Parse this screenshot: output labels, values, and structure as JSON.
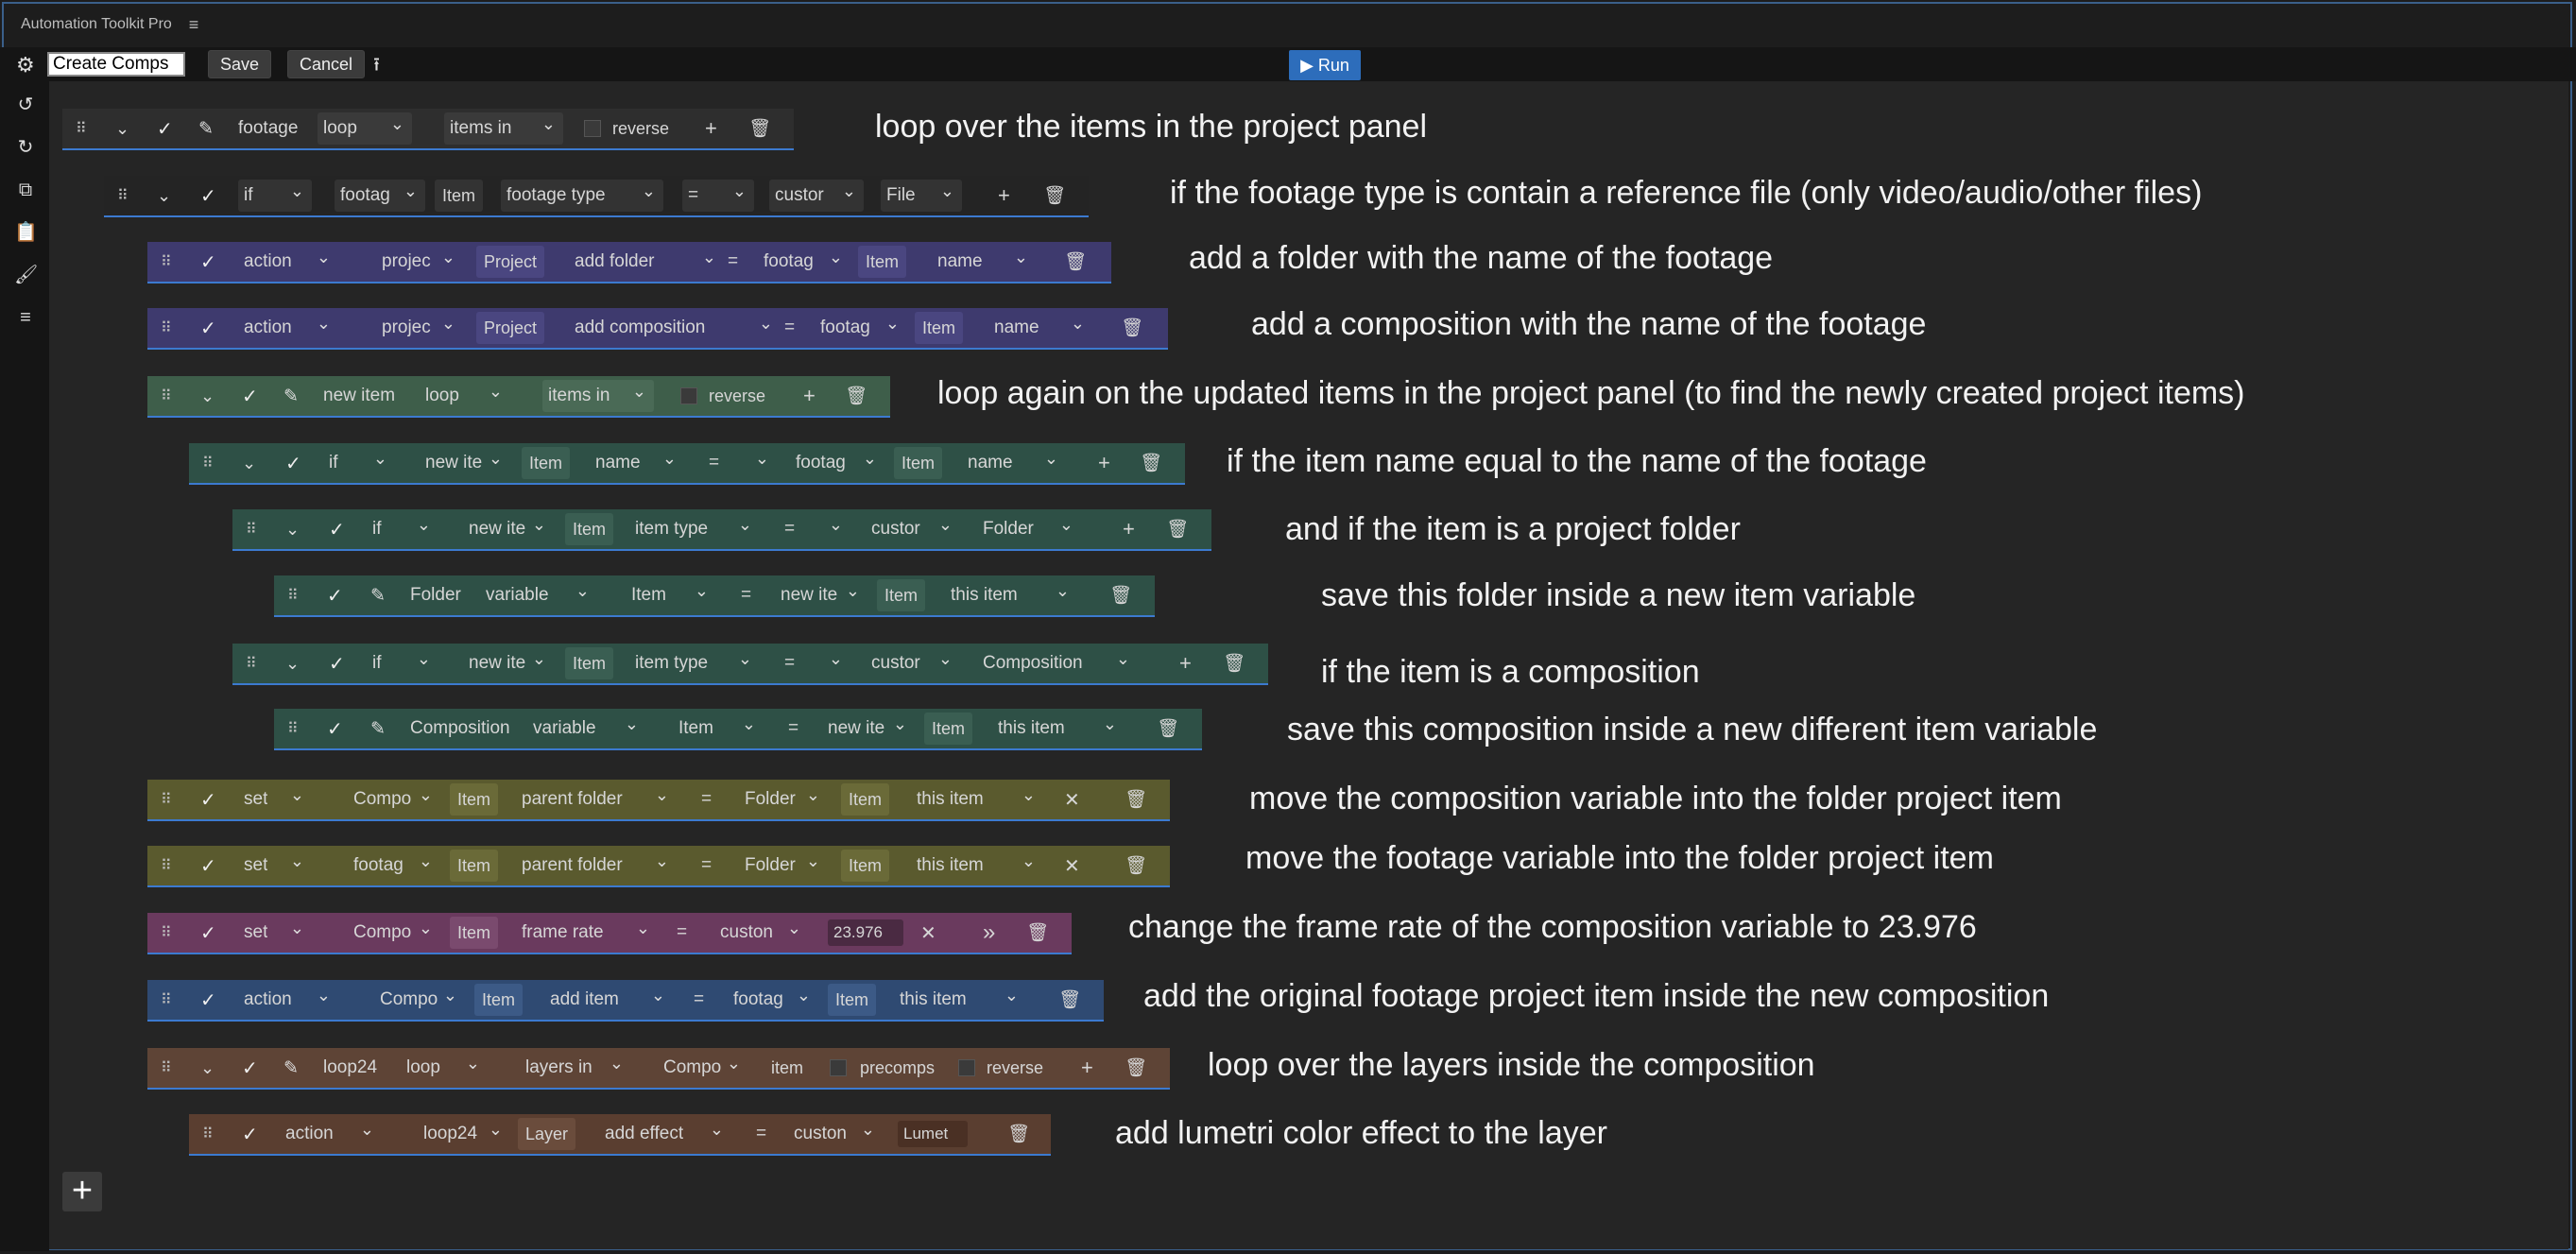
{
  "app": {
    "title": "Automation Toolkit Pro"
  },
  "toolbar": {
    "script_name": "Create Comps",
    "save": "Save",
    "cancel": "Cancel",
    "run": "▶ Run"
  },
  "rows": {
    "r1": {
      "var": "footage",
      "type": "loop",
      "src": "items in",
      "reverse": "reverse"
    },
    "r2": {
      "kind": "if",
      "var": "footag",
      "item": "Item",
      "prop": "footage type",
      "op": "=",
      "vtype": "custor",
      "value": "File"
    },
    "r3": {
      "kind": "action",
      "target": "projec",
      "item": "Project",
      "method": "add folder",
      "op": "=",
      "arg": "footag",
      "item2": "Item",
      "prop": "name"
    },
    "r4": {
      "kind": "action",
      "target": "projec",
      "item": "Project",
      "method": "add composition",
      "op": "=",
      "arg": "footag",
      "item2": "Item",
      "prop": "name"
    },
    "r5": {
      "var": "new item",
      "type": "loop",
      "src": "items in",
      "reverse": "reverse"
    },
    "r6": {
      "kind": "if",
      "var": "new ite",
      "item": "Item",
      "prop": "name",
      "op": "=",
      "arg": "footag",
      "item2": "Item",
      "prop2": "name"
    },
    "r7": {
      "kind": "if",
      "var": "new ite",
      "item": "Item",
      "prop": "item type",
      "op": "=",
      "vtype": "custor",
      "value": "Folder"
    },
    "r8": {
      "name": "Folder",
      "kind": "variable",
      "vtype": "Item",
      "op": "=",
      "arg": "new ite",
      "item2": "Item",
      "prop": "this item"
    },
    "r9": {
      "kind": "if",
      "var": "new ite",
      "item": "Item",
      "prop": "item type",
      "op": "=",
      "vtype": "custor",
      "value": "Composition"
    },
    "r10": {
      "name": "Composition",
      "kind": "variable",
      "vtype": "Item",
      "op": "=",
      "arg": "new ite",
      "item2": "Item",
      "prop": "this item"
    },
    "r11": {
      "kind": "set",
      "var": "Compo",
      "item": "Item",
      "prop": "parent folder",
      "op": "=",
      "arg": "Folder",
      "item2": "Item",
      "prop2": "this item",
      "x": "✕"
    },
    "r12": {
      "kind": "set",
      "var": "footag",
      "item": "Item",
      "prop": "parent folder",
      "op": "=",
      "arg": "Folder",
      "item2": "Item",
      "prop2": "this item",
      "x": "✕"
    },
    "r13": {
      "kind": "set",
      "var": "Compo",
      "item": "Item",
      "prop": "frame rate",
      "op": "=",
      "vtype": "custon",
      "value": "23.976",
      "x": "✕",
      "more": "»"
    },
    "r14": {
      "kind": "action",
      "target": "Compo",
      "item": "Item",
      "method": "add item",
      "op": "=",
      "arg": "footag",
      "item2": "Item",
      "prop": "this item"
    },
    "r15": {
      "var": "loop24",
      "type": "loop",
      "src": "layers in",
      "comp": "Compo",
      "item": "item",
      "precomps": "precomps",
      "reverse": "reverse"
    },
    "r16": {
      "kind": "action",
      "target": "loop24",
      "item": "Layer",
      "method": "add effect",
      "op": "=",
      "vtype": "custon",
      "value": "Lumet"
    }
  },
  "annotations": [
    "loop over the items in the project panel",
    "if the footage type is contain a reference file (only video/audio/other files)",
    "add a folder with the name of the footage",
    "add a composition with the name of the footage",
    "loop again on the updated items in the project panel (to find the newly created project items)",
    "if the item name equal to the name of the footage",
    "and if the item is a project folder",
    "save this folder inside a new item variable",
    "if the item is a composition",
    "save this composition inside a new different item variable",
    "move the composition variable into the folder project item",
    "move the footage variable into the folder project item",
    "change the frame rate of the composition variable to 23.976",
    "add the original footage project item inside the new composition",
    "loop over the layers inside the composition",
    "add lumetri color effect to the layer"
  ],
  "colors": {
    "loop": "#3a3a3a",
    "if": "#2a2a2a",
    "action_blue": "#3e3a6e",
    "loop_green": "#3e5e4a",
    "if_green": "#2e5046",
    "var_green": "#2e5046",
    "set_olive": "#5a5a2e",
    "set_magenta": "#6a3a5e",
    "action_steel": "#2f4a72",
    "loop_brown": "#5e4436",
    "action_brown": "#5a3e30",
    "accent": "#2d6dbb"
  }
}
